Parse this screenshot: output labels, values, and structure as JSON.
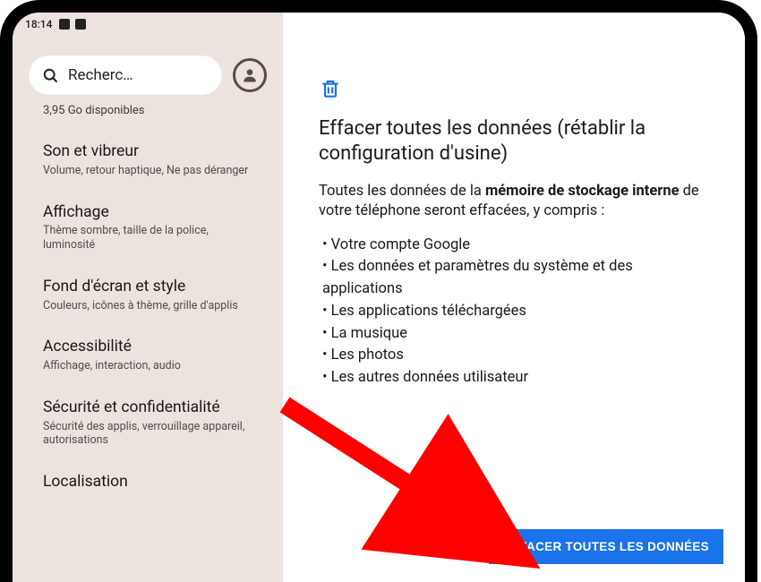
{
  "statusbar": {
    "time": "18:14"
  },
  "sidebar": {
    "search_placeholder": "Recherc…",
    "storage_available": "3,95 Go disponibles",
    "items": [
      {
        "title": "Son et vibreur",
        "subtitle": "Volume, retour haptique, Ne pas déranger"
      },
      {
        "title": "Affichage",
        "subtitle": "Thème sombre, taille de la police, luminosité"
      },
      {
        "title": "Fond d'écran et style",
        "subtitle": "Couleurs, icônes à thème, grille d'applis"
      },
      {
        "title": "Accessibilité",
        "subtitle": "Affichage, interaction, audio"
      },
      {
        "title": "Sécurité et confidentialité",
        "subtitle": "Sécurité des applis, verrouillage appareil, autorisations"
      },
      {
        "title": "Localisation",
        "subtitle": ""
      }
    ]
  },
  "main": {
    "heading": "Effacer toutes les données (rétablir la configuration d'usine)",
    "intro_pre": "Toutes les données de la ",
    "intro_bold": "mémoire de stockage interne",
    "intro_post": " de votre téléphone seront effacées, y compris :",
    "bullets": [
      "Votre compte Google",
      "Les données et paramètres du système et des applications",
      "Les applications téléchargées",
      "La musique",
      "Les photos",
      "Les autres données utilisateur"
    ],
    "action_label": "EFFACER TOUTES LES DONNÉES"
  },
  "colors": {
    "accent": "#1a73e8",
    "annotation": "#ff0000"
  }
}
